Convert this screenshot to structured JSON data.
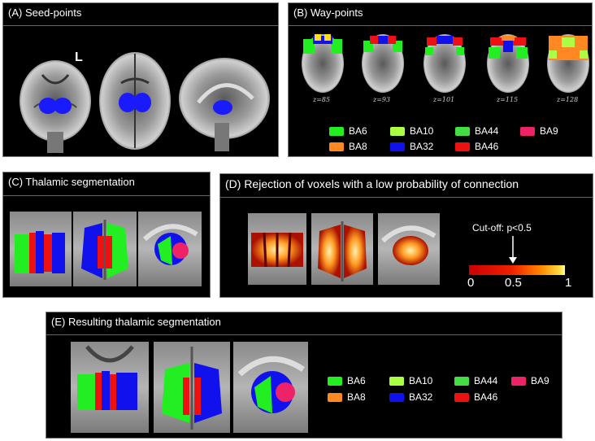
{
  "panels": {
    "a": {
      "title": "(A) Seed-points",
      "side_marker": "L"
    },
    "b": {
      "title": "(B) Way-points",
      "slices": [
        "z=85",
        "z=93",
        "z=101",
        "z=115",
        "z=128"
      ]
    },
    "c": {
      "title": "(C) Thalamic segmentation"
    },
    "d": {
      "title": "(D) Rejection of voxels with a low probability of connection",
      "cutoff_label": "Cut-off: p<0.5",
      "scale_min": "0",
      "scale_mid": "0.5",
      "scale_max": "1"
    },
    "e": {
      "title": "(E) Resulting  thalamic segmentation"
    }
  },
  "legend": [
    {
      "label": "BA6",
      "color": "#22ee22"
    },
    {
      "label": "BA10",
      "color": "#aaff44"
    },
    {
      "label": "BA44",
      "color": "#44dd44"
    },
    {
      "label": "BA9",
      "color": "#ee2266"
    },
    {
      "label": "BA8",
      "color": "#ff8822"
    },
    {
      "label": "BA32",
      "color": "#1111ee"
    },
    {
      "label": "BA46",
      "color": "#ee1111"
    }
  ],
  "colors": {
    "background": "#000000",
    "seed": "#1a1aff",
    "border": "#777777"
  }
}
